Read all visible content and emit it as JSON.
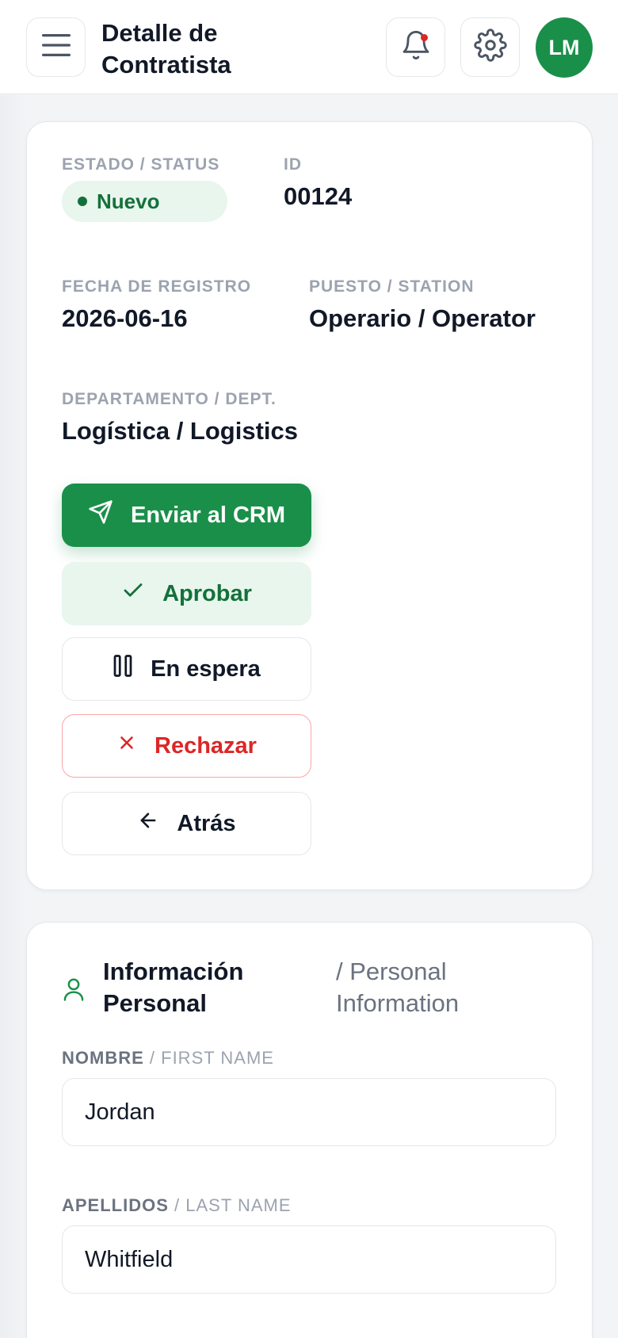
{
  "header": {
    "title": "Detalle de Contratista",
    "avatar_initials": "LM",
    "icons": {
      "menu": "menu-icon",
      "bell": "bell-icon",
      "settings": "gear-icon"
    }
  },
  "summary": {
    "status_label": "ESTADO / STATUS",
    "status_value": "Nuevo",
    "id_label": "ID",
    "id_value": "00124",
    "date_label": "FECHA DE REGISTRO",
    "date_value": "2026-06-16",
    "station_label": "PUESTO / STATION",
    "station_value": "Operario / Operator",
    "dept_label": "DEPARTAMENTO / DEPT.",
    "dept_value": "Logística / Logistics"
  },
  "actions": {
    "send_crm": "Enviar al CRM",
    "approve": "Aprobar",
    "on_hold": "En espera",
    "reject": "Rechazar",
    "back": "Atrás"
  },
  "personal": {
    "title": "Información Personal",
    "subtitle": "/ Personal Information",
    "first_name_label_es": "NOMBRE",
    "first_name_label_en": "/ FIRST NAME",
    "first_name_value": "Jordan",
    "last_name_label_es": "APELLIDOS",
    "last_name_label_en": "/ LAST NAME",
    "last_name_value": "Whitfield"
  },
  "colors": {
    "brand_green": "#1a8f4a",
    "status_green": "#14703a",
    "status_bg": "#e8f6ee",
    "danger_red": "#dc2626",
    "notification_dot": "#dc2626"
  }
}
